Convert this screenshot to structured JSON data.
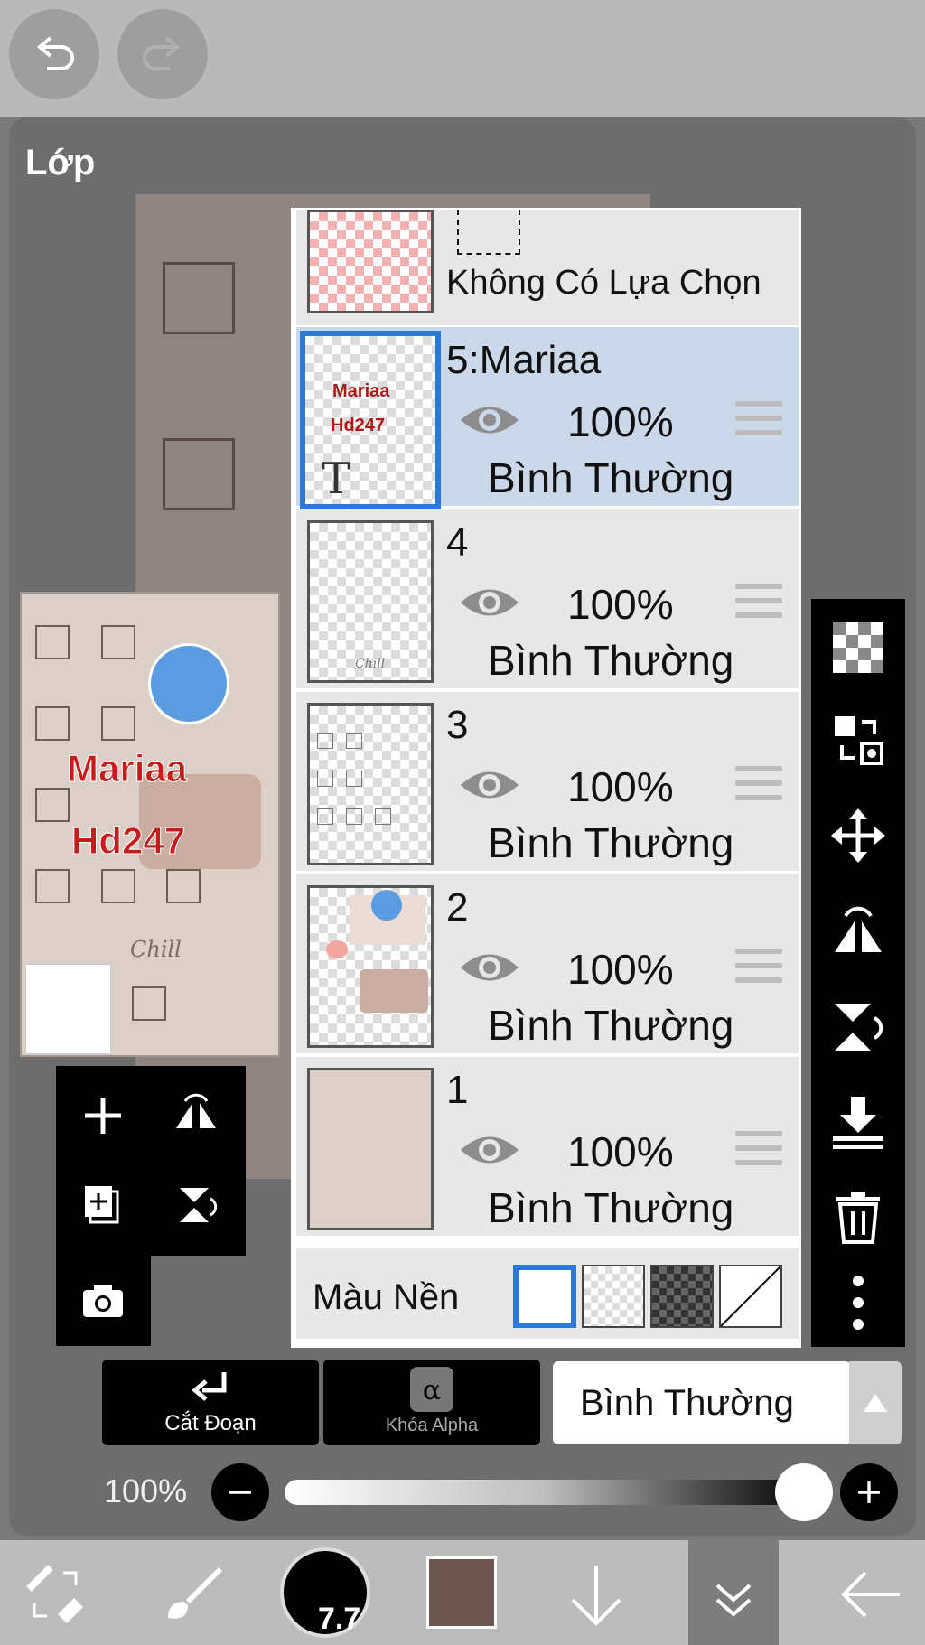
{
  "panel": {
    "title": "Lớp"
  },
  "preview": {
    "text_line1": "Mariaa",
    "text_line2": "Hd247",
    "chill": "Chill"
  },
  "selection_row": {
    "label": "Không Có Lựa Chọn"
  },
  "layers": [
    {
      "name": "5:Mariaa",
      "opacity": "100%",
      "blend": "Bình Thường",
      "active": true,
      "thumb_text1": "Mariaa",
      "thumb_text2": "Hd247",
      "thumb_glyph": "T"
    },
    {
      "name": "4",
      "opacity": "100%",
      "blend": "Bình Thường",
      "active": false
    },
    {
      "name": "3",
      "opacity": "100%",
      "blend": "Bình Thường",
      "active": false
    },
    {
      "name": "2",
      "opacity": "100%",
      "blend": "Bình Thường",
      "active": false
    },
    {
      "name": "1",
      "opacity": "100%",
      "blend": "Bình Thường",
      "active": false
    }
  ],
  "background_color": {
    "label": "Màu Nền",
    "options": [
      "white",
      "light-checker",
      "dark-checker",
      "none"
    ],
    "selected": "white"
  },
  "actions": {
    "clip_label": "Cắt Đoạn",
    "alpha_lock_label": "Khóa Alpha",
    "alpha_glyph": "α"
  },
  "blend_mode": {
    "value": "Bình Thường"
  },
  "opacity": {
    "label": "100%",
    "value": 1.0
  },
  "bottom_toolbar": {
    "brush_size": "7.7",
    "primary_color": "#6b5650"
  },
  "colors": {
    "selected_border": "#2a78d8",
    "active_row": "#cbd8ea",
    "text_red": "#c81b1b"
  }
}
